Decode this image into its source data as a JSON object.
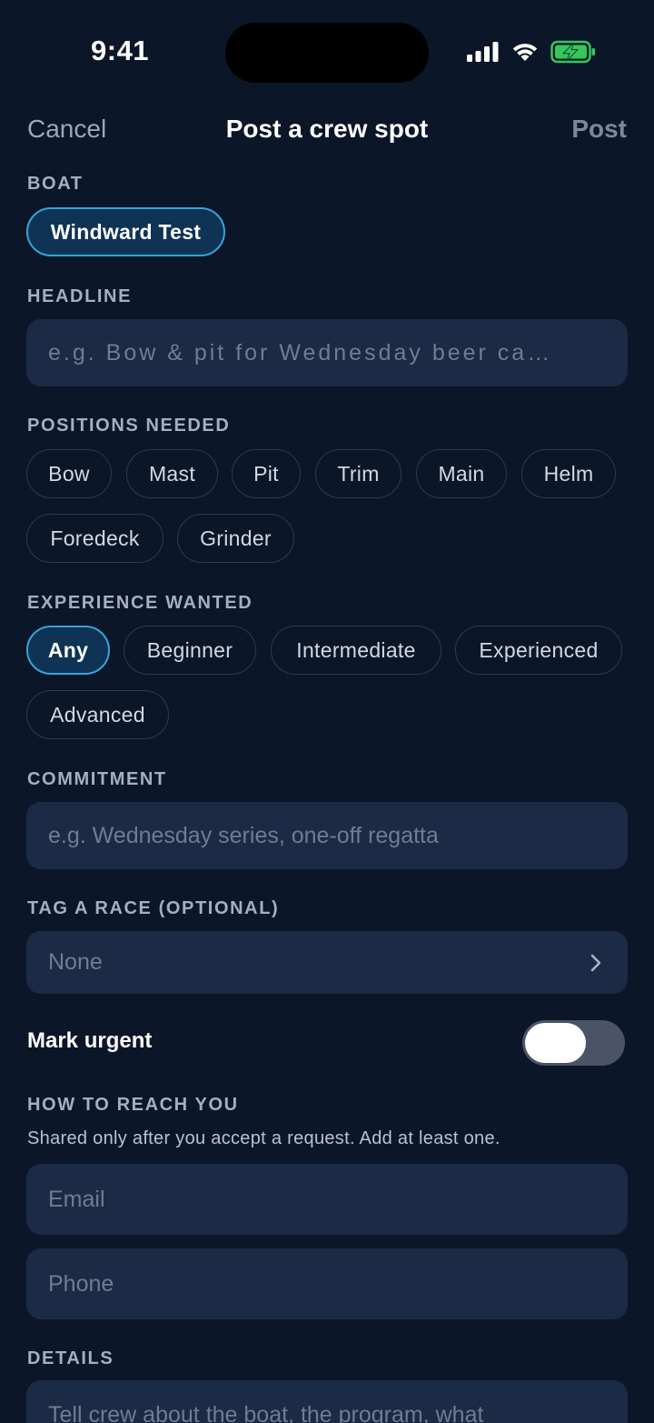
{
  "status_bar": {
    "time": "9:41"
  },
  "nav": {
    "cancel_label": "Cancel",
    "title": "Post a crew spot",
    "post_label": "Post"
  },
  "boat": {
    "label": "BOAT",
    "selected": "Windward Test"
  },
  "headline": {
    "label": "HEADLINE",
    "placeholder": "e.g. Bow & pit for Wednesday beer ca…"
  },
  "positions": {
    "label": "POSITIONS NEEDED",
    "options": [
      "Bow",
      "Mast",
      "Pit",
      "Trim",
      "Main",
      "Helm",
      "Foredeck",
      "Grinder"
    ]
  },
  "experience": {
    "label": "EXPERIENCE WANTED",
    "options": [
      "Any",
      "Beginner",
      "Intermediate",
      "Experienced",
      "Advanced"
    ],
    "selected": "Any"
  },
  "commitment": {
    "label": "COMMITMENT",
    "placeholder": "e.g. Wednesday series, one-off regatta"
  },
  "race": {
    "label": "TAG A RACE (OPTIONAL)",
    "value": "None"
  },
  "urgent": {
    "label": "Mark urgent",
    "on": false
  },
  "contact": {
    "label": "HOW TO REACH YOU",
    "helper": "Shared only after you accept a request. Add at least one.",
    "email_placeholder": "Email",
    "phone_placeholder": "Phone"
  },
  "details": {
    "label": "DETAILS",
    "placeholder": "Tell crew about the boat, the program, what"
  },
  "colors": {
    "background": "#0c1629",
    "field": "#1b2a45",
    "accent": "#38a3d8",
    "chip_selected_bg": "#0f3354",
    "battery": "#34c759"
  },
  "icons": [
    "signal-icon",
    "wifi-icon",
    "battery-charging-icon",
    "chevron-right-icon"
  ]
}
